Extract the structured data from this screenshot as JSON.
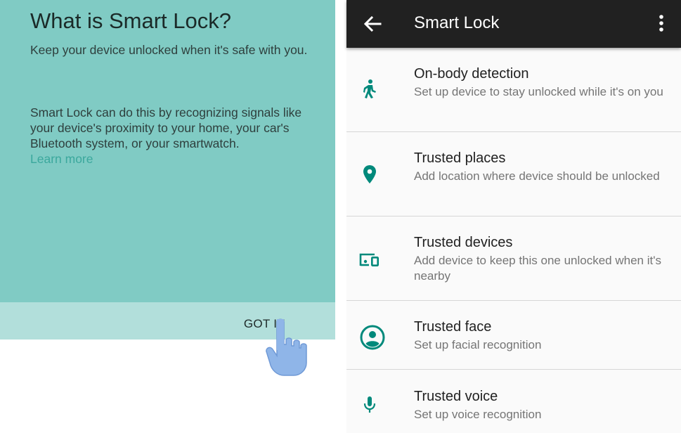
{
  "intro": {
    "title": "What is Smart Lock?",
    "subtitle": "Keep your device unlocked when it's safe with you.",
    "body": "Smart Lock can do this by recognizing signals like your device's proximity to your home, your car's Bluetooth system, or your smartwatch.",
    "learn_more": "Learn more",
    "got_it": "GOT IT",
    "background_color": "#80cbc4",
    "action_bar_color": "#b2dfdb",
    "link_color": "#3ba89d"
  },
  "app_bar": {
    "title": "Smart Lock",
    "back_icon": "arrow-left-icon",
    "menu_icon": "more-vert-icon",
    "background_color": "#212121"
  },
  "accent_color": "#00897b",
  "options": [
    {
      "icon": "walking-person-icon",
      "title": "On-body detection",
      "subtitle": "Set up device to stay unlocked while it's on you"
    },
    {
      "icon": "location-pin-icon",
      "title": "Trusted places",
      "subtitle": "Add location where device should be unlocked"
    },
    {
      "icon": "devices-icon",
      "title": "Trusted devices",
      "subtitle": "Add device to keep this one unlocked when it's nearby"
    },
    {
      "icon": "face-icon",
      "title": "Trusted face",
      "subtitle": "Set up facial recognition"
    },
    {
      "icon": "microphone-icon",
      "title": "Trusted voice",
      "subtitle": "Set up voice recognition"
    }
  ]
}
